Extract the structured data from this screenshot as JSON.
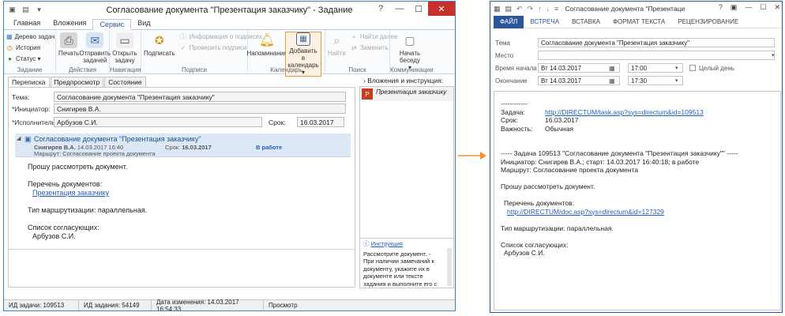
{
  "left_window": {
    "title": "Согласование документа \"Презентация заказчику\" - Задание",
    "tabs": [
      "Главная",
      "Вложения",
      "Сервис",
      "Вид"
    ],
    "ribbon": {
      "task": {
        "items": [
          "Дерево задач",
          "История",
          "Статус"
        ],
        "label": "Задание"
      },
      "actions": {
        "print": "Печать",
        "send": "Отправить задачей",
        "label": "Действия"
      },
      "navigation": {
        "open": "Открыть задачу",
        "label": "Навигация"
      },
      "signatures": {
        "sign": "Подписать",
        "info": "Информация о подписях",
        "check": "Проверить подписи",
        "label": "Подписи"
      },
      "calendar": {
        "remind": "Напоминания",
        "add": "Добавить в календарь",
        "label": "Календарь"
      },
      "search": {
        "find": "Найти",
        "find_next": "Найти далее",
        "replace": "Заменить",
        "label": "Поиск"
      },
      "comm": {
        "start": "Начать беседу",
        "label": "Коммуникации"
      }
    },
    "subtabs": [
      "Переписка",
      "Предпросмотр",
      "Состояние"
    ],
    "form": {
      "subject_label": "Тема:",
      "subject": "Согласование документа \"Презентация заказчику\"",
      "initiator_label": "*Инициатор:",
      "initiator": "Снигирев В.А.",
      "executor_label": "*Исполнитель:",
      "executor": "Арбузов С.И.",
      "due_label": "Срок:",
      "due": "16.03.2017"
    },
    "message": {
      "title": "Согласование документа \"Презентация заказчику\"",
      "author": "Снигирев В.А.",
      "date": "14.03.2017 16:40",
      "due_label": "Срок:",
      "due": "16.03.2017",
      "status": "В работе",
      "route": "Маршрут: Согласование проекта документа",
      "body": [
        "Прошу рассмотреть документ.",
        "",
        "Перечень документов:",
        "Презентация заказчику",
        "",
        "Тип маршрутизации: параллельная.",
        "",
        "Список согласующих:",
        "Арбузов С.И."
      ]
    },
    "attachments_header": "Вложения и инструкция:",
    "attachment": "Презентация заказчику",
    "instruction_link": "Инструкция",
    "instruction_text": "Рассмотрите документ. - При наличии замечаний к документу, укажите их в документе или тексте задания и выполните его с результатом \"На",
    "status_bar": [
      "ИД задачи: 109513",
      "ИД задания: 54149",
      "Дата изменения: 14.03.2017 16:54:33",
      "Просмотр"
    ]
  },
  "right_window": {
    "title": "Согласование документа \"Презентация заказчику\"",
    "tabs": [
      "ФАЙЛ",
      "ВСТРЕЧА",
      "ВСТАВКА",
      "ФОРМАТ ТЕКСТА",
      "РЕЦЕНЗИРОВАНИЕ"
    ],
    "subject_label": "Тема",
    "subject": "Согласование документа \"Презентация заказчику\"",
    "location_label": "Место",
    "location": "",
    "start_label": "Время начала",
    "start_date": "Вт 14.03.2017",
    "start_time": "17:00",
    "allday_label": "Целый день",
    "end_label": "Окончание",
    "end_date": "Вт 14.03.2017",
    "end_time": "17:30",
    "body": {
      "sep": "------------",
      "task_label": "Задача:",
      "task_link": "http://DIRECTUM/task.asp?sys=directum&id=109513",
      "due_label": "Срок:",
      "due": "16.03.2017",
      "importance_label": "Важность:",
      "importance": "Обычная",
      "header": "----- Задача 109513 \"Согласование документа \"Презентация заказчику\"\" -----",
      "initiator": "Инициатор: Снигирев В.А.; старт: 14.03.2017 16:40:18; в работе",
      "route": "Маршрут: Согласование проекта документа",
      "request": "Прошу рассмотреть документ.",
      "docs_label": "Перечень документов:",
      "doc_link": "http://DIRECTUM/doc.asp?sys=directum&id=127329",
      "routing": "Тип маршрутизации: параллельная.",
      "approvers_label": "Список согласующих:",
      "approver": "Арбузов С.И."
    }
  },
  "colors": {
    "accent": "#2b579a",
    "arrow": "#f0913a",
    "message_bg": "#dde8f6",
    "selected": "#e59a4a"
  }
}
